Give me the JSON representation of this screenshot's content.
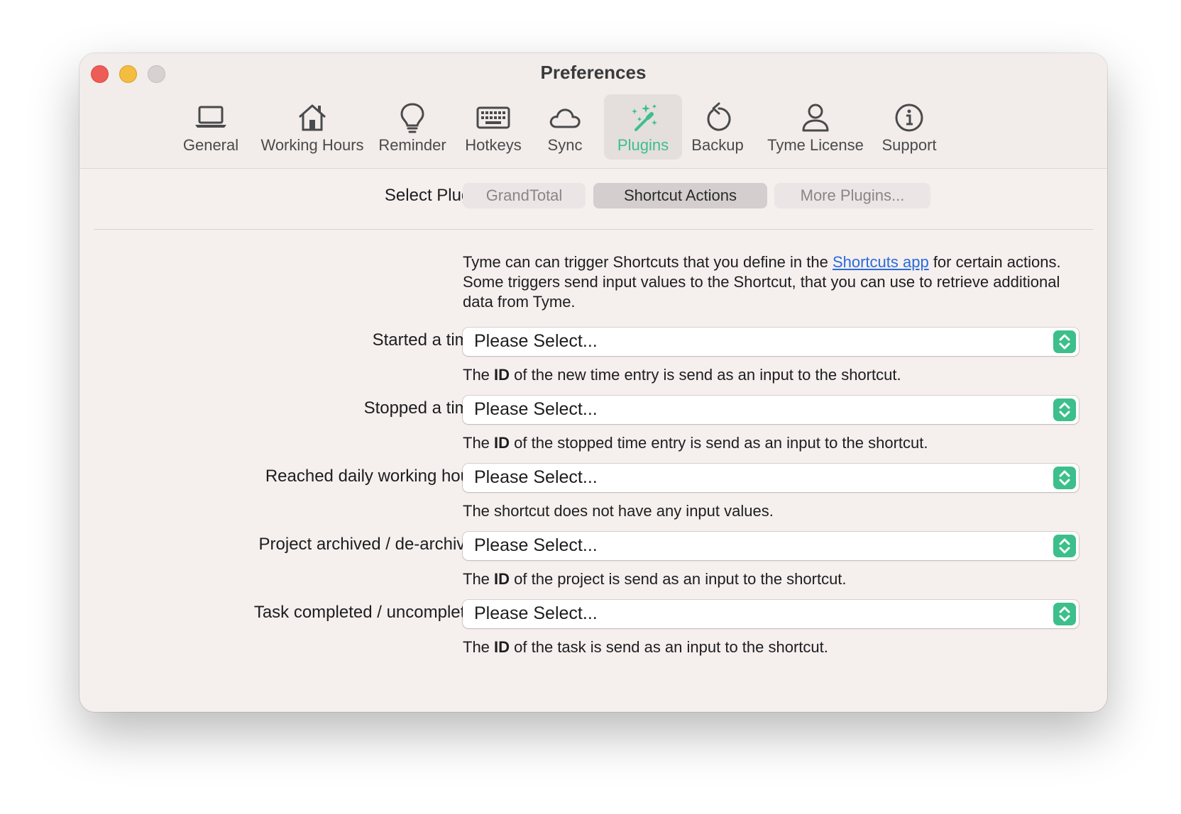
{
  "window": {
    "title": "Preferences"
  },
  "toolbar": {
    "tabs": [
      {
        "label": "General",
        "icon": "laptop-icon"
      },
      {
        "label": "Working Hours",
        "icon": "home-icon"
      },
      {
        "label": "Reminder",
        "icon": "lightbulb-icon"
      },
      {
        "label": "Hotkeys",
        "icon": "keyboard-icon"
      },
      {
        "label": "Sync",
        "icon": "cloud-icon"
      },
      {
        "label": "Plugins",
        "icon": "magic-wand-icon",
        "active": true
      },
      {
        "label": "Backup",
        "icon": "restore-arrow-icon"
      },
      {
        "label": "Tyme License",
        "icon": "person-icon"
      },
      {
        "label": "Support",
        "icon": "info-icon"
      }
    ],
    "accent_color": "#3cbf8b"
  },
  "plugin_selector": {
    "label": "Select Plugin",
    "options": [
      "GrandTotal",
      "Shortcut Actions",
      "More Plugins..."
    ],
    "selected": "Shortcut Actions"
  },
  "intro": {
    "before_link": "Tyme can can trigger Shortcuts that you define in the ",
    "link": "Shortcuts app",
    "after_link": " for certain actions. Some triggers send input values to the Shortcut, that you can use to retrieve additional data from Tyme."
  },
  "triggers": [
    {
      "label": "Started a timer",
      "value": "Please Select...",
      "hint_pre": "The ",
      "hint_bold": "ID",
      "hint_post": " of the new time entry is send as an input to the shortcut."
    },
    {
      "label": "Stopped a timer",
      "value": "Please Select...",
      "hint_pre": "The ",
      "hint_bold": "ID",
      "hint_post": " of the stopped time entry is send as an input to the shortcut."
    },
    {
      "label": "Reached daily working hours",
      "value": "Please Select...",
      "hint_pre": "The shortcut does not have any input values.",
      "hint_bold": "",
      "hint_post": ""
    },
    {
      "label": "Project archived / de-archived",
      "value": "Please Select...",
      "hint_pre": "The ",
      "hint_bold": "ID",
      "hint_post": " of the project is send as an input to the shortcut."
    },
    {
      "label": "Task completed / uncompleted",
      "value": "Please Select...",
      "hint_pre": "The ",
      "hint_bold": "ID",
      "hint_post": " of the task is send as an input to the shortcut."
    }
  ]
}
